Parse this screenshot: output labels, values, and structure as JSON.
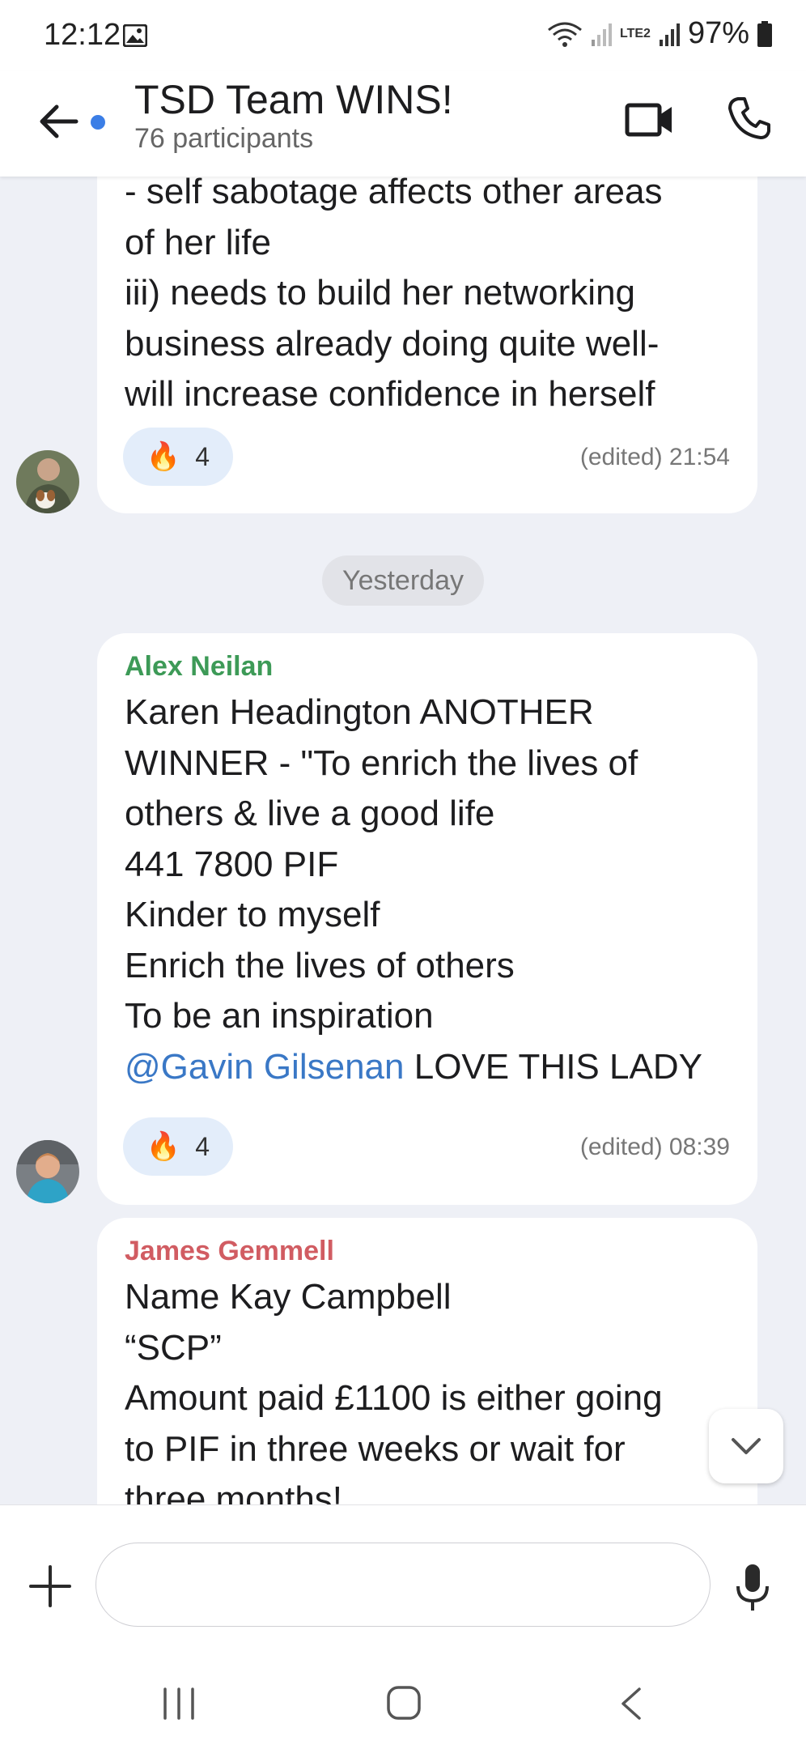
{
  "status_bar": {
    "time": "12:12",
    "battery": "97%",
    "network_label": "LTE2"
  },
  "header": {
    "title": "TSD Team WINS!",
    "subtitle": "76 participants"
  },
  "messages": [
    {
      "sender": "",
      "lines": [
        "- self sabotage affects other areas",
        "of her life",
        "iii) needs to build her networking",
        "business already doing quite well-",
        "will increase confidence in herself"
      ],
      "reaction_emoji": "🔥",
      "reaction_count": "4",
      "meta": "(edited) 21:54"
    },
    {
      "sender": "Alex Neilan",
      "sender_color": "#3d9a57",
      "lines": [
        "Karen Headington ANOTHER",
        "WINNER - \"To enrich the lives of",
        "others & live a good life",
        "441 7800 PIF",
        "Kinder to myself",
        "Enrich the lives of others",
        "To be an inspiration"
      ],
      "mention": "@Gavin Gilsenan",
      "mention_suffix": " LOVE THIS LADY",
      "reaction_emoji": "🔥",
      "reaction_count": "4",
      "meta": "(edited) 08:39"
    },
    {
      "sender": "James Gemmell",
      "sender_color": "#d15c62",
      "lines": [
        "Name Kay Campbell",
        "“SCP”",
        "Amount paid £1100 is either going",
        "to PIF in three weeks or wait for",
        "three months!"
      ]
    }
  ],
  "day_separator": "Yesterday",
  "composer": {
    "placeholder": ""
  },
  "colors": {
    "accent": "#3b7ee6",
    "chat_background": "#eef0f6",
    "reaction_background": "#e3edfa"
  }
}
